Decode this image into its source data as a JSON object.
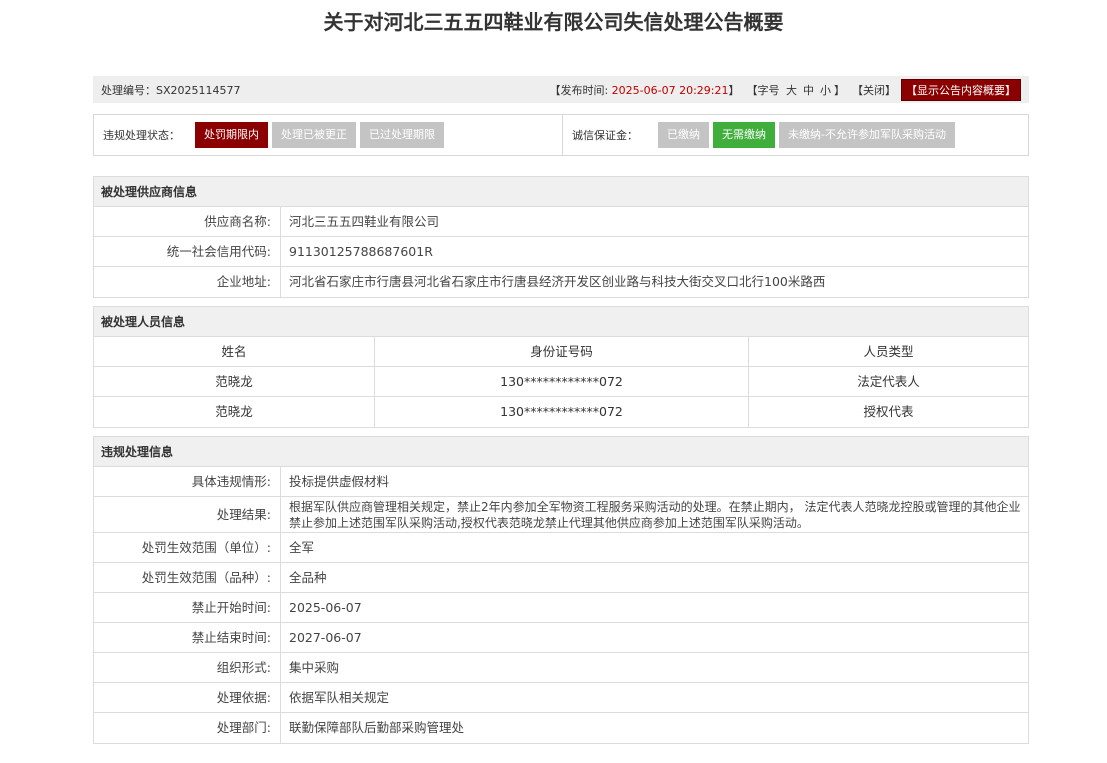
{
  "page_title": "关于对河北三五五四鞋业有限公司失信处理公告概要",
  "meta": {
    "ref_label": "处理编号：",
    "ref_value": "SX2025114577",
    "publish_prefix": "【发布时间: ",
    "publish_time": "2025-06-07 20:29:21",
    "publish_suffix": "】",
    "font_prefix": "【字号",
    "font_large": "大",
    "font_medium": "中",
    "font_small": "小",
    "font_suffix": "】",
    "close_label": "【关闭】",
    "summary_label": "【显示公告内容概要】"
  },
  "status": {
    "violation_label": "违规处理状态：",
    "violation_tags": [
      "处罚期限内",
      "处理已被更正",
      "已过处理期限"
    ],
    "deposit_label": "诚信保证金：",
    "deposit_tags": [
      "已缴纳",
      "无需缴纳",
      "未缴纳-不允许参加军队采购活动"
    ]
  },
  "supplier": {
    "heading": "被处理供应商信息",
    "name_label": "供应商名称:",
    "name_value": "河北三五五四鞋业有限公司",
    "credit_label": "统一社会信用代码:",
    "credit_value": "91130125788687601R",
    "address_label": "企业地址:",
    "address_value": "河北省石家庄市行唐县河北省石家庄市行唐县经济开发区创业路与科技大街交叉口北行100米路西"
  },
  "persons": {
    "heading": "被处理人员信息",
    "columns": [
      "姓名",
      "身份证号码",
      "人员类型"
    ],
    "rows": [
      [
        "范晓龙",
        "130************072",
        "法定代表人"
      ],
      [
        "范晓龙",
        "130************072",
        "授权代表"
      ]
    ]
  },
  "violation": {
    "heading": "违规处理信息",
    "items": [
      {
        "label": "具体违规情形:",
        "value": "投标提供虚假材料"
      },
      {
        "label": "处理结果:",
        "value": "根据军队供应商管理相关规定，禁止2年内参加全军物资工程服务采购活动的处理。在禁止期内， 法定代表人范晓龙控股或管理的其他企业禁止参加上述范围军队采购活动,授权代表范晓龙禁止代理其他供应商参加上述范围军队采购活动。"
      },
      {
        "label": "处罚生效范围（单位）:",
        "value": "全军"
      },
      {
        "label": "处罚生效范围（品种）:",
        "value": "全品种"
      },
      {
        "label": "禁止开始时间:",
        "value": "2025-06-07"
      },
      {
        "label": "禁止结束时间:",
        "value": "2027-06-07"
      },
      {
        "label": "组织形式:",
        "value": "集中采购"
      },
      {
        "label": "处理依据:",
        "value": "依据军队相关规定"
      },
      {
        "label": "处理部门:",
        "value": "联勤保障部队后勤部采购管理处"
      }
    ]
  },
  "colors": {
    "active_red": "#8b0000",
    "active_green": "#3fae3b",
    "inactive_gray": "#c4c4c4",
    "time_red": "#c00000"
  }
}
